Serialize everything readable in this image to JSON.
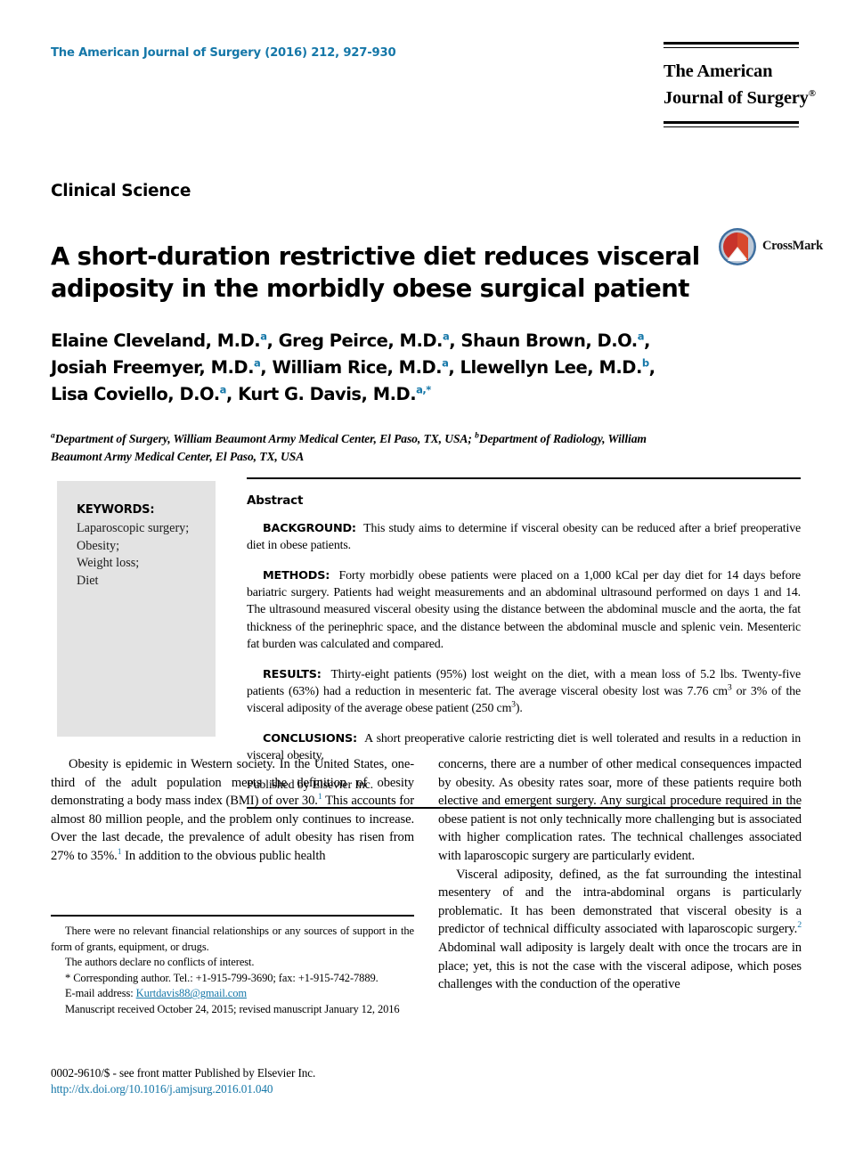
{
  "accent_color": "#1577a8",
  "masthead": {
    "journal_reference": "The American Journal of Surgery (2016) 212, 927-930",
    "logo_line1": "The American",
    "logo_line2": "Journal of Surgery",
    "logo_registered": "®"
  },
  "article": {
    "section_label": "Clinical Science",
    "title": "A short-duration restrictive diet reduces visceral adiposity in the morbidly obese surgical patient",
    "crossmark_label": "CrossMark"
  },
  "authors": {
    "line1": "Elaine Cleveland, M.D.",
    "line1_sup1": "a",
    "line1_b": ", Greg Peirce, M.D.",
    "line1_sup2": "a",
    "line1_c": ", Shaun Brown, D.O.",
    "line1_sup3": "a",
    "line1_d": ",",
    "line2": "Josiah Freemyer, M.D.",
    "line2_sup1": "a",
    "line2_b": ", William Rice, M.D.",
    "line2_sup2": "a",
    "line2_c": ", Llewellyn Lee, M.D.",
    "line2_sup3": "b",
    "line2_d": ",",
    "line3": "Lisa Coviello, D.O.",
    "line3_sup1": "a",
    "line3_b": ", Kurt G. Davis, M.D.",
    "line3_sup2": "a,*"
  },
  "affiliations": {
    "sup_a": "a",
    "text_a": "Department of Surgery, William Beaumont Army Medical Center, El Paso, TX, USA; ",
    "sup_b": "b",
    "text_b": "Department of Radiology, William Beaumont Army Medical Center, El Paso, TX, USA"
  },
  "keywords": {
    "title": "KEYWORDS:",
    "items": [
      "Laparoscopic surgery;",
      "Obesity;",
      "Weight loss;",
      "Diet"
    ]
  },
  "abstract": {
    "heading": "Abstract",
    "background_label": "BACKGROUND:",
    "background_text": "This study aims to determine if visceral obesity can be reduced after a brief preoperative diet in obese patients.",
    "methods_label": "METHODS:",
    "methods_text": "Forty morbidly obese patients were placed on a 1,000 kCal per day diet for 14 days before bariatric surgery. Patients had weight measurements and an abdominal ultrasound performed on days 1 and 14. The ultrasound measured visceral obesity using the distance between the abdominal muscle and the aorta, the fat thickness of the perinephric space, and the distance between the abdominal muscle and splenic vein. Mesenteric fat burden was calculated and compared.",
    "results_label": "RESULTS:",
    "results_text_1": "Thirty-eight patients (95%) lost weight on the diet, with a mean loss of 5.2 lbs. Twenty-five patients (63%) had a reduction in mesenteric fat. The average visceral obesity lost was 7.76 cm",
    "results_sup_1": "3",
    "results_text_2": " or 3% of the visceral adiposity of the average obese patient (250 cm",
    "results_sup_2": "3",
    "results_text_3": ").",
    "conclusions_label": "CONCLUSIONS:",
    "conclusions_text": "A short preoperative calorie restricting diet is well tolerated and results in a reduction in visceral obesity.",
    "publisher": "Published by Elsevier Inc."
  },
  "body": {
    "left_para_1_a": "Obesity is epidemic in Western society. In the United States, one-third of the adult population meets the definition of obesity demonstrating a body mass index (BMI) of over 30.",
    "left_para_1_sup1": "1",
    "left_para_1_b": " This accounts for almost 80 million people, and the problem only continues to increase. Over the last decade, the prevalence of adult obesity has risen from 27% to 35%.",
    "left_para_1_sup2": "1",
    "left_para_1_c": " In addition to the obvious public health",
    "right_para_1": "concerns, there are a number of other medical consequences impacted by obesity. As obesity rates soar, more of these patients require both elective and emergent surgery. Any surgical procedure required in the obese patient is not only technically more challenging but is associated with higher complication rates. The technical challenges associated with laparoscopic surgery are particularly evident.",
    "right_para_2_a": "Visceral adiposity, defined, as the fat surrounding the intestinal mesentery of and the intra-abdominal organs is particularly problematic. It has been demonstrated that visceral obesity is a predictor of technical difficulty associated with laparoscopic surgery.",
    "right_para_2_sup": "2",
    "right_para_2_b": " Abdominal wall adiposity is largely dealt with once the trocars are in place; yet, this is not the case with the visceral adipose, which poses challenges with the conduction of the operative"
  },
  "footnotes": {
    "funding": "There were no relevant financial relationships or any sources of support in the form of grants, equipment, or drugs.",
    "conflicts": "The authors declare no conflicts of interest.",
    "corresponding_marker": "*",
    "corresponding": "Corresponding author. Tel.: +1-915-799-3690; fax: +1-915-742-7889.",
    "email_label": "E-mail address:",
    "email_value": "Kurtdavis88@gmail.com",
    "manuscript_dates": "Manuscript received October 24, 2015; revised manuscript January 12, 2016"
  },
  "footer": {
    "issn_line": "0002-9610/$ - see front matter Published by Elsevier Inc.",
    "doi_url": "http://dx.doi.org/10.1016/j.amjsurg.2016.01.040"
  }
}
